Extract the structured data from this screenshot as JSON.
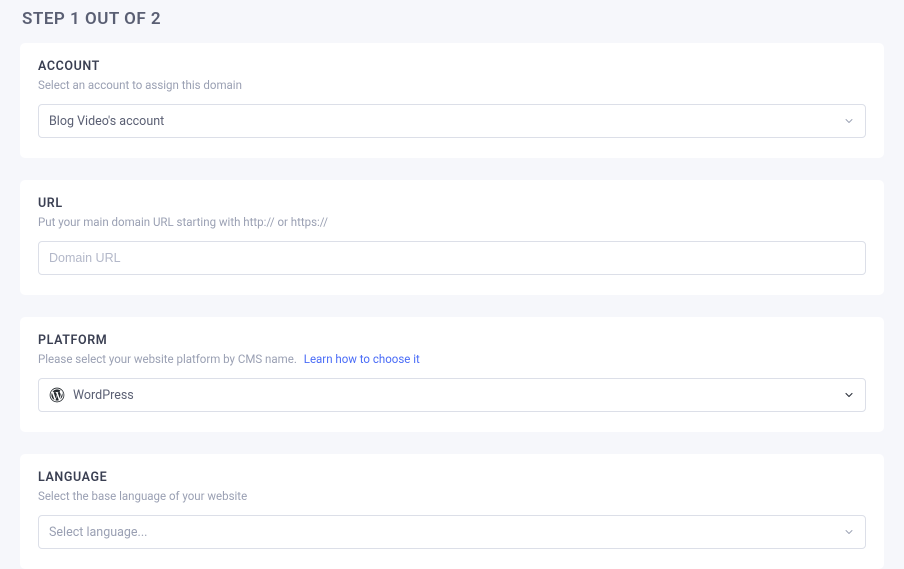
{
  "step_title": "STEP 1 OUT OF 2",
  "account": {
    "heading": "ACCOUNT",
    "subtext": "Select an account to assign this domain",
    "selected": "Blog Video's account"
  },
  "url": {
    "heading": "URL",
    "subtext": "Put your main domain URL starting with http:// or https://",
    "placeholder": "Domain URL"
  },
  "platform": {
    "heading": "PLATFORM",
    "subtext": "Please select your website platform by CMS name.",
    "learn_link": "Learn how to choose it",
    "selected": "WordPress",
    "icon": "wordpress-icon"
  },
  "language": {
    "heading": "LANGUAGE",
    "subtext": "Select the base language of your website",
    "placeholder": "Select language..."
  }
}
